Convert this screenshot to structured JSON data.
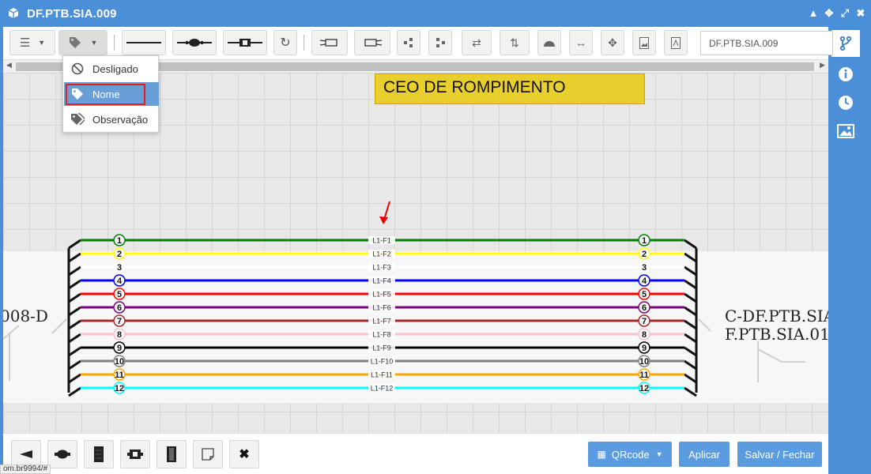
{
  "window": {
    "title": "DF.PTB.SIA.009"
  },
  "toolbar": {
    "search_value": "DF.PTB.SIA.009"
  },
  "dropdown": {
    "items": [
      {
        "label": "Desligado",
        "icon": "ban-icon"
      },
      {
        "label": "Nome",
        "icon": "tag-icon",
        "selected": true
      },
      {
        "label": "Observação",
        "icon": "tags-icon"
      }
    ]
  },
  "diagram": {
    "title": "CEO DE ROMPIMENTO",
    "left_label": "008-D",
    "right_label_1": "C-DF.PTB.SIA",
    "right_label_2": "F.PTB.SIA.01",
    "fibers": [
      {
        "num": "1",
        "name": "L1-F1",
        "color": "#008000"
      },
      {
        "num": "2",
        "name": "L1-F2",
        "color": "#ffff00"
      },
      {
        "num": "3",
        "name": "L1-F3",
        "color": "#ffffff"
      },
      {
        "num": "4",
        "name": "L1-F4",
        "color": "#0000ff"
      },
      {
        "num": "5",
        "name": "L1-F5",
        "color": "#ff0000"
      },
      {
        "num": "6",
        "name": "L1-F6",
        "color": "#800080"
      },
      {
        "num": "7",
        "name": "L1-F7",
        "color": "#a52a2a"
      },
      {
        "num": "8",
        "name": "L1-F8",
        "color": "#ffc0cb"
      },
      {
        "num": "9",
        "name": "L1-F9",
        "color": "#000000"
      },
      {
        "num": "10",
        "name": "L1-F10",
        "color": "#808080"
      },
      {
        "num": "11",
        "name": "L1-F11",
        "color": "#ffa500"
      },
      {
        "num": "12",
        "name": "L1-F12",
        "color": "#00ffff"
      }
    ]
  },
  "bottom": {
    "qrcode_label": "QRcode",
    "apply_label": "Aplicar",
    "save_label": "Salvar / Fechar"
  },
  "status_text": "om.br9994/#"
}
